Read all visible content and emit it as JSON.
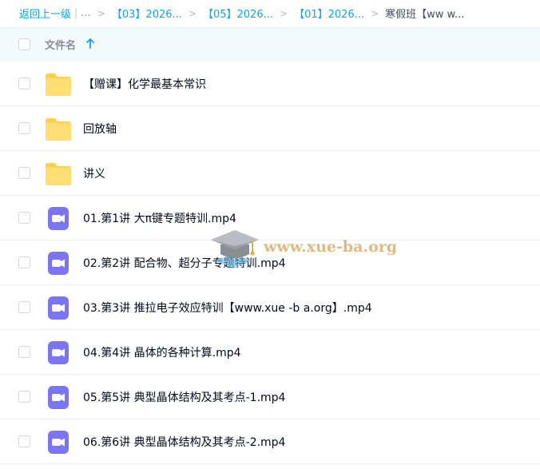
{
  "breadcrumb": {
    "back_label": "返回上一级",
    "pipe": "|",
    "dots": "...",
    "separator": ">",
    "crumbs": [
      "【03】2026...",
      "【05】2026...",
      "【01】2026..."
    ],
    "current": "寒假班【ww w..."
  },
  "file_list": {
    "header_label": "文件名",
    "sort_icon": "arrow-up-icon",
    "rows": [
      {
        "name": "【赠课】化学最基本常识",
        "type": "folder"
      },
      {
        "name": "回放轴",
        "type": "folder"
      },
      {
        "name": "讲义",
        "type": "folder"
      },
      {
        "name": "01.第1讲 大π键专题特训.mp4",
        "type": "video"
      },
      {
        "name": "02.第2讲 配合物、超分子专题特训.mp4",
        "type": "video"
      },
      {
        "name": "03.第3讲 推拉电子效应特训【www.xue -b a.org】.mp4",
        "type": "video"
      },
      {
        "name": "04.第4讲 晶体的各种计算.mp4",
        "type": "video"
      },
      {
        "name": "05.第5讲 典型晶体结构及其考点-1.mp4",
        "type": "video"
      },
      {
        "name": "06.第6讲 典型晶体结构及其考点-2.mp4",
        "type": "video"
      }
    ]
  },
  "watermark": {
    "text": "www.xue-ba.org",
    "icon": "graduation-cap-icon"
  },
  "colors": {
    "link": "#06a7ff",
    "header_bg": "#f3fafe",
    "folder": "#ffd558",
    "video": "#7773f5",
    "watermark": "#d6a860"
  }
}
